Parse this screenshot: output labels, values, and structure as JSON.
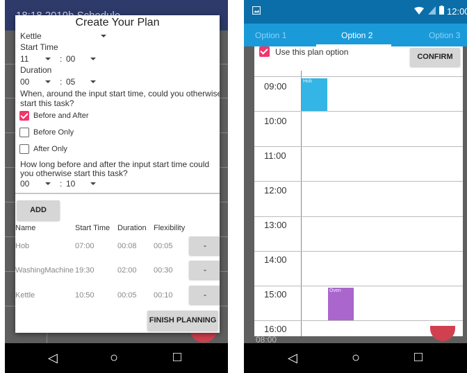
{
  "left": {
    "appbar_title": "18:18 2019b Schedule",
    "dialog": {
      "title": "Create Your Plan",
      "appliance_value": "Kettle",
      "start_time_label": "Start Time",
      "start_hour": "11",
      "start_min": "00",
      "time_sep": ":",
      "duration_label": "Duration",
      "duration_hour": "00",
      "duration_min": "05",
      "question1": [
        "When, around the input start time, could you otherwise",
        "start this task?"
      ],
      "options": [
        {
          "label": "Before and After",
          "checked": true
        },
        {
          "label": "Before Only",
          "checked": false
        },
        {
          "label": "After Only",
          "checked": false
        }
      ],
      "question2": [
        "How long before and after the input start time could",
        "you otherwise start this task?"
      ],
      "flex_hour": "00",
      "flex_min": "10",
      "add_label": "ADD",
      "columns": [
        "Name",
        "Start Time",
        "Duration",
        "Flexibility"
      ],
      "rows": [
        {
          "name": "Hob",
          "start": "07:00",
          "duration": "00:08",
          "flex": "00:05",
          "remove": "-"
        },
        {
          "name": "WashingMachine",
          "start": "19:30",
          "duration": "02:00",
          "flex": "00:30",
          "remove": "-"
        },
        {
          "name": "Kettle",
          "start": "10:50",
          "duration": "00:05",
          "flex": "00:10",
          "remove": "-"
        }
      ],
      "finish_label": "FINISH PLANNING"
    },
    "nav": {
      "back": "◁",
      "home": "○",
      "recent": "□"
    }
  },
  "right": {
    "status_time": "12:00",
    "tabs": [
      {
        "label": "Option 1",
        "selected": false
      },
      {
        "label": "Option 2",
        "selected": true
      },
      {
        "label": "Option 3",
        "selected": false
      }
    ],
    "use_option_label": "Use this plan option",
    "use_option_checked": true,
    "confirm_label": "CONFIRM",
    "hours": [
      "09:00",
      "10:00",
      "11:00",
      "12:00",
      "13:00",
      "14:00",
      "15:00",
      "16:00"
    ],
    "blocks": [
      {
        "label": "Hob",
        "color": "#33b5e5"
      },
      {
        "label": "Oven",
        "color": "#aa66cc"
      }
    ],
    "behind_text": "08:00",
    "nav": {
      "back": "◁",
      "home": "○",
      "recent": "□"
    }
  },
  "colors": {
    "accent": "#f0366b",
    "tab_bar": "#1a9ad9",
    "status_bar": "#0b6ea8",
    "fab": "#d1404f"
  }
}
